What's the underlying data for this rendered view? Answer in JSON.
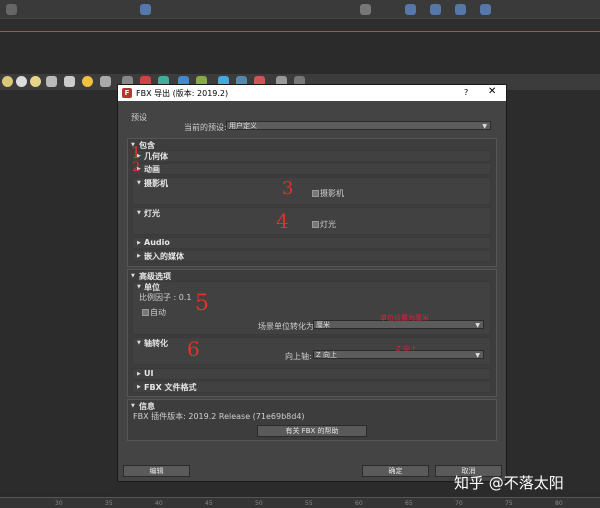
{
  "dialog": {
    "title": "FBX 导出 (版本: 2019.2)",
    "help": "?",
    "close": "✕",
    "preset_section": "预设",
    "current_preset_label": "当前的预设:",
    "current_preset_value": "用户定义",
    "include_section": "包含",
    "geometry": "几何体",
    "animation": "动画",
    "camera": "摄影机",
    "camera_checkbox": "摄影机",
    "lights": "灯光",
    "lights_checkbox": "灯光",
    "audio": "Audio",
    "embed_media": "嵌入的媒体",
    "advanced_section": "高级选项",
    "units": "单位",
    "scale_factor": "比例因子 : 0.1",
    "auto": "自动",
    "scene_units_label": "场景单位转化为:",
    "scene_units_value": "厘米",
    "axis_conversion": "轴转化",
    "up_axis_label": "向上轴:",
    "up_axis_value": "Z 向上",
    "ui": "UI",
    "fbx_format": "FBX 文件格式",
    "info_section": "信息",
    "plugin_version": "FBX 插件版本: 2019.2 Release (71e69b8d4)",
    "about_button": "有关 FBX 的帮助",
    "edit_button": "编辑",
    "ok_button": "确定",
    "cancel_button": "取消"
  },
  "annotations": {
    "n1": "1",
    "n2": "2",
    "n3": "3",
    "n4": "4",
    "n5": "5",
    "n6": "6",
    "units_note": "单位设置为厘米",
    "axis_note": "Z 向上"
  },
  "ruler": [
    "30",
    "35",
    "40",
    "45",
    "50",
    "55",
    "60",
    "65",
    "70",
    "75",
    "80",
    "85",
    "90"
  ],
  "watermark": "知乎 @不落太阳"
}
